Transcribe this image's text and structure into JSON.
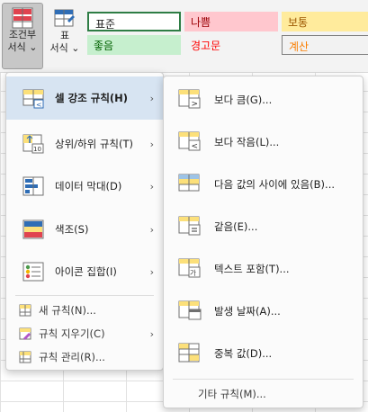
{
  "ribbon": {
    "conditional_format_label": [
      "조건부",
      "서식"
    ],
    "table_format_label": [
      "표",
      "서식"
    ],
    "styles": [
      {
        "label": "표준",
        "bg": "#ffffff",
        "fg": "#1f1f1f"
      },
      {
        "label": "나쁨",
        "bg": "#ffc7ce",
        "fg": "#9c0006"
      },
      {
        "label": "보통",
        "bg": "#ffeb9c",
        "fg": "#9c5700"
      },
      {
        "label": "좋음",
        "bg": "#c6efce",
        "fg": "#006100"
      },
      {
        "label": "경고문",
        "bg": "#f3f3f3",
        "fg": "#ff0000"
      },
      {
        "label": "계산",
        "bg": "#f2f2f2",
        "fg": "#fa7d00"
      }
    ]
  },
  "menu": {
    "items": [
      {
        "label": "셀 강조 규칙(H)",
        "has_submenu": true,
        "highlighted": true
      },
      {
        "label": "상위/하위 규칙(T)",
        "has_submenu": true
      },
      {
        "label": "데이터 막대(D)",
        "has_submenu": true
      },
      {
        "label": "색조(S)",
        "has_submenu": true
      },
      {
        "label": "아이콘 집합(I)",
        "has_submenu": true
      }
    ],
    "small_items": [
      {
        "label": "새 규칙(N)..."
      },
      {
        "label": "규칙 지우기(C)",
        "has_submenu": true
      },
      {
        "label": "규칙 관리(R)..."
      }
    ]
  },
  "submenu": {
    "items": [
      {
        "label": "보다 큼(G)..."
      },
      {
        "label": "보다 작음(L)..."
      },
      {
        "label": "다음 값의 사이에 있음(B)..."
      },
      {
        "label": "같음(E)..."
      },
      {
        "label": "텍스트 포함(T)..."
      },
      {
        "label": "발생 날짜(A)..."
      },
      {
        "label": "중복 값(D)..."
      }
    ],
    "footer": "기타 규칙(M)..."
  },
  "colors": {
    "highlight": "#d7e4f2",
    "accent_blue": "#2f6db5",
    "icon_red": "#e0434f",
    "icon_yellow": "#fce07a"
  }
}
